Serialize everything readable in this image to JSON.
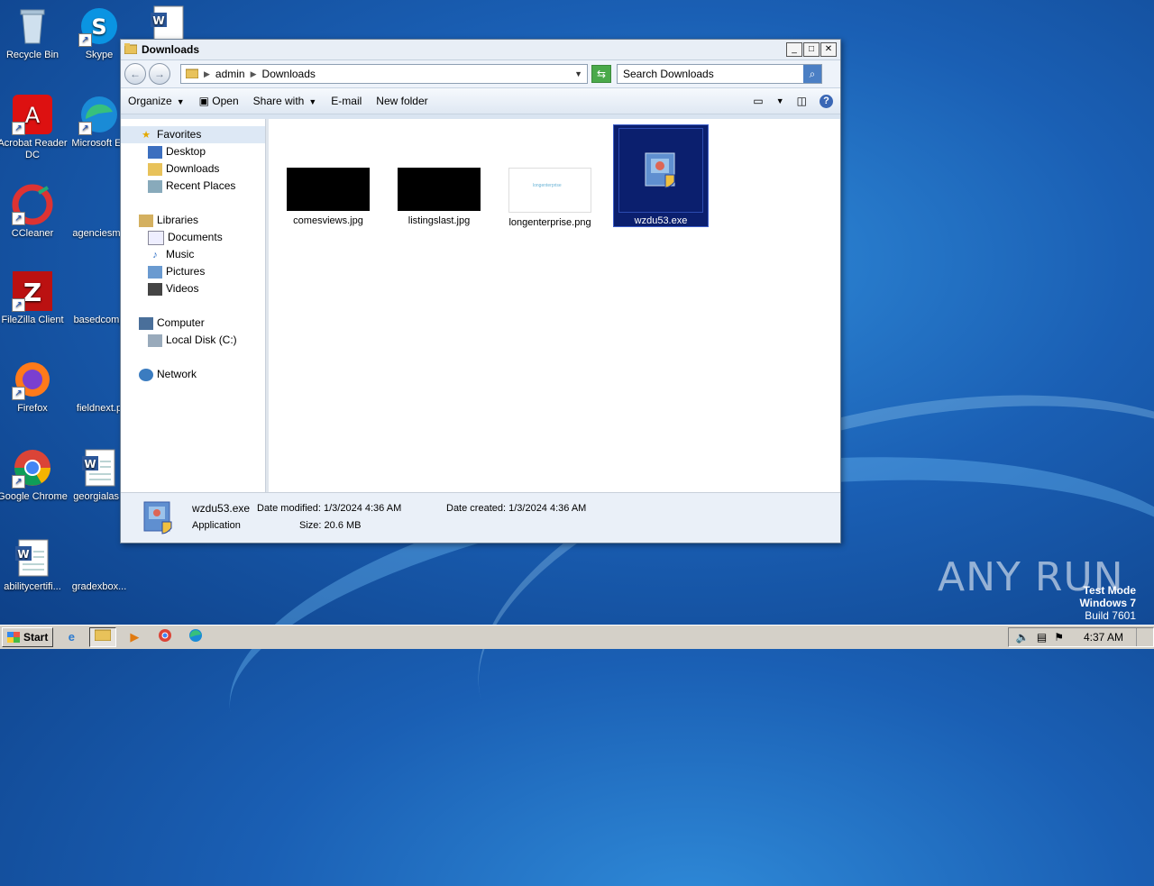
{
  "desktop": {
    "icons": [
      {
        "label": "Recycle Bin"
      },
      {
        "label": "Skype"
      },
      {
        "label": "Acrobat Reader DC"
      },
      {
        "label": "Microsoft Ed"
      },
      {
        "label": "CCleaner"
      },
      {
        "label": "agenciesma"
      },
      {
        "label": "FileZilla Client"
      },
      {
        "label": "basedcomp"
      },
      {
        "label": "Firefox"
      },
      {
        "label": "fieldnext.p"
      },
      {
        "label": "Google Chrome"
      },
      {
        "label": "georgialas.r"
      },
      {
        "label": "abilitycertifi..."
      },
      {
        "label": "gradexbox..."
      }
    ]
  },
  "window": {
    "title": "Downloads",
    "address": {
      "segments": [
        "admin",
        "Downloads"
      ]
    },
    "search_placeholder": "Search Downloads",
    "toolbar": {
      "organize": "Organize",
      "open": "Open",
      "share_with": "Share with",
      "email": "E-mail",
      "new_folder": "New folder"
    },
    "nav": {
      "favorites": "Favorites",
      "desktop": "Desktop",
      "downloads": "Downloads",
      "recent_places": "Recent Places",
      "libraries": "Libraries",
      "documents": "Documents",
      "music": "Music",
      "pictures": "Pictures",
      "videos": "Videos",
      "computer": "Computer",
      "local_disk": "Local Disk (C:)",
      "network": "Network"
    },
    "files": [
      {
        "name": "comesviews.jpg"
      },
      {
        "name": "listingslast.jpg"
      },
      {
        "name": "longenterprise.png",
        "thumb_text": "longenterprise"
      },
      {
        "name": "wzdu53.exe"
      }
    ],
    "status": {
      "name": "wzdu53.exe",
      "type": "Application",
      "date_modified_label": "Date modified:",
      "date_modified": "1/3/2024 4:36 AM",
      "size_label": "Size:",
      "size": "20.6 MB",
      "date_created_label": "Date created:",
      "date_created": "1/3/2024 4:36 AM"
    }
  },
  "taskbar": {
    "start": "Start",
    "clock": "4:37 AM"
  },
  "watermark": {
    "line1": "Test Mode",
    "line2": "Windows 7",
    "line3": "Build 7601",
    "brand": "ANY RUN"
  }
}
